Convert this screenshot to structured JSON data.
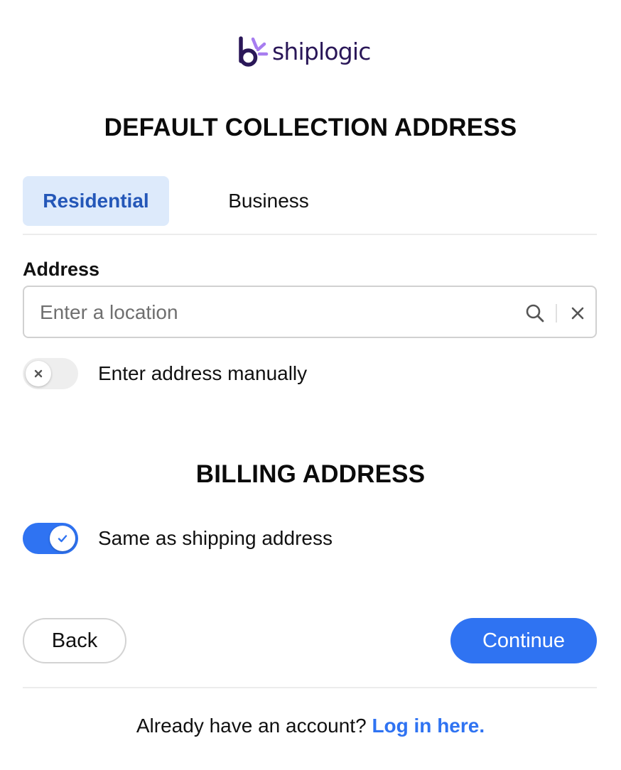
{
  "brand": {
    "name": "shiplogic",
    "logo_color": "#2a1758",
    "accent": "#a77df0"
  },
  "collection": {
    "title": "DEFAULT COLLECTION ADDRESS",
    "tabs": [
      {
        "label": "Residential",
        "selected": true
      },
      {
        "label": "Business",
        "selected": false
      }
    ],
    "address_label": "Address",
    "address_value": "",
    "address_placeholder": "Enter a location",
    "manual_toggle": {
      "label": "Enter address manually",
      "on": false
    }
  },
  "billing": {
    "title": "BILLING ADDRESS",
    "same_toggle": {
      "label": "Same as shipping address",
      "on": true
    }
  },
  "buttons": {
    "back": "Back",
    "continue": "Continue"
  },
  "footer": {
    "prompt": "Already have an account?",
    "link": "Log in here."
  },
  "colors": {
    "primary": "#2f73f2",
    "tab_selected_bg": "#ddeafb",
    "tab_selected_text": "#2457b8"
  },
  "icons": [
    "logo-icon",
    "search-icon",
    "close-icon",
    "x-icon",
    "check-icon"
  ]
}
